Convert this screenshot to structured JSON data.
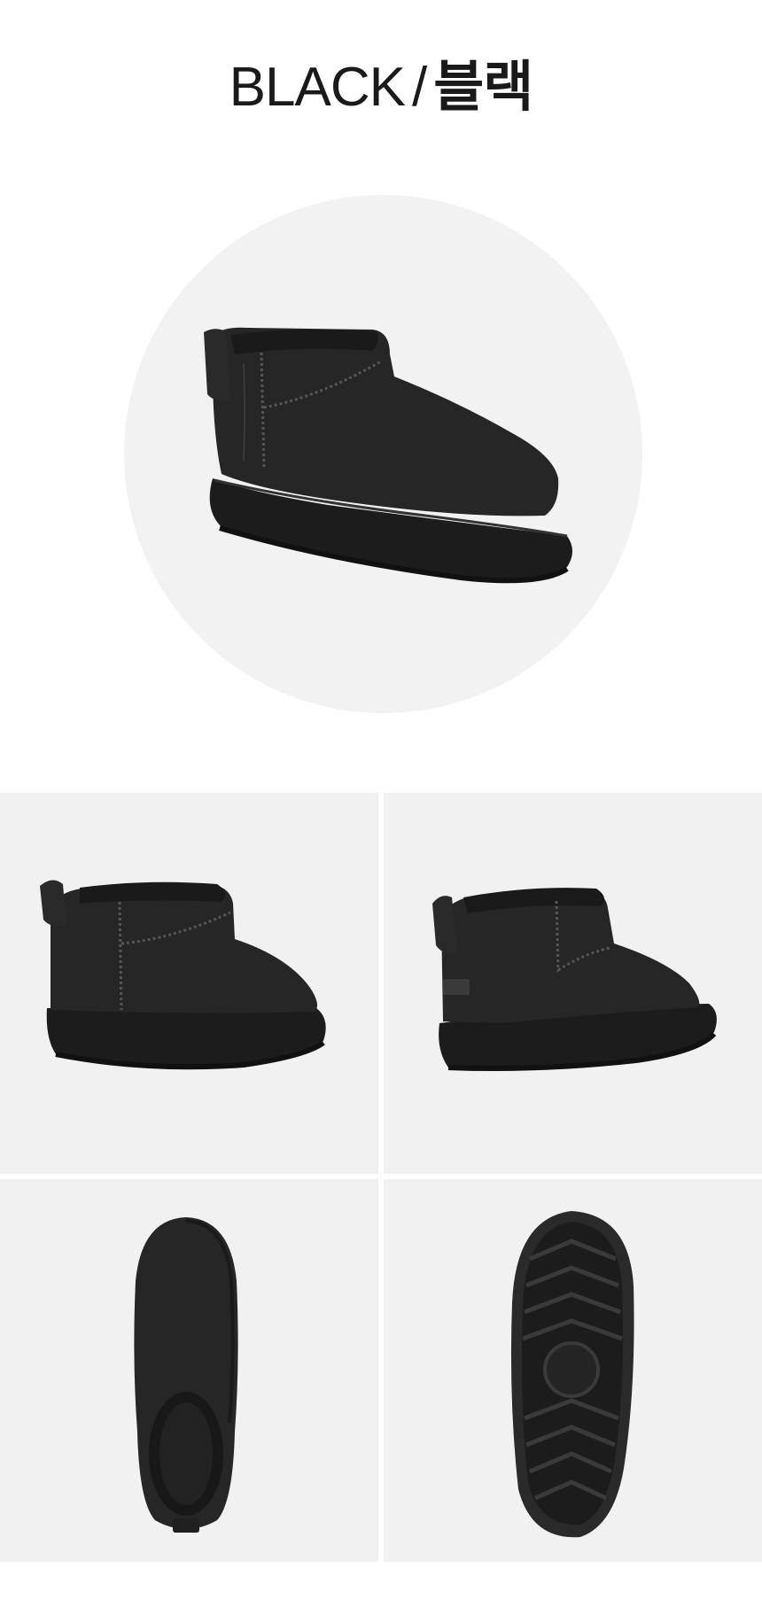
{
  "header": {
    "color_en": "BLACK",
    "separator": "/",
    "color_ko": "블랙"
  },
  "colors": {
    "background": "#ffffff",
    "circle": "#f2f2f2",
    "panel": "#f1f1f1",
    "boot": "#262626",
    "sole": "#1c1c1c"
  },
  "images": {
    "hero": "boot-three-quarter-view",
    "grid": [
      "boot-side-view-left",
      "boot-side-view-right",
      "boot-top-view",
      "boot-outsole-view"
    ]
  }
}
